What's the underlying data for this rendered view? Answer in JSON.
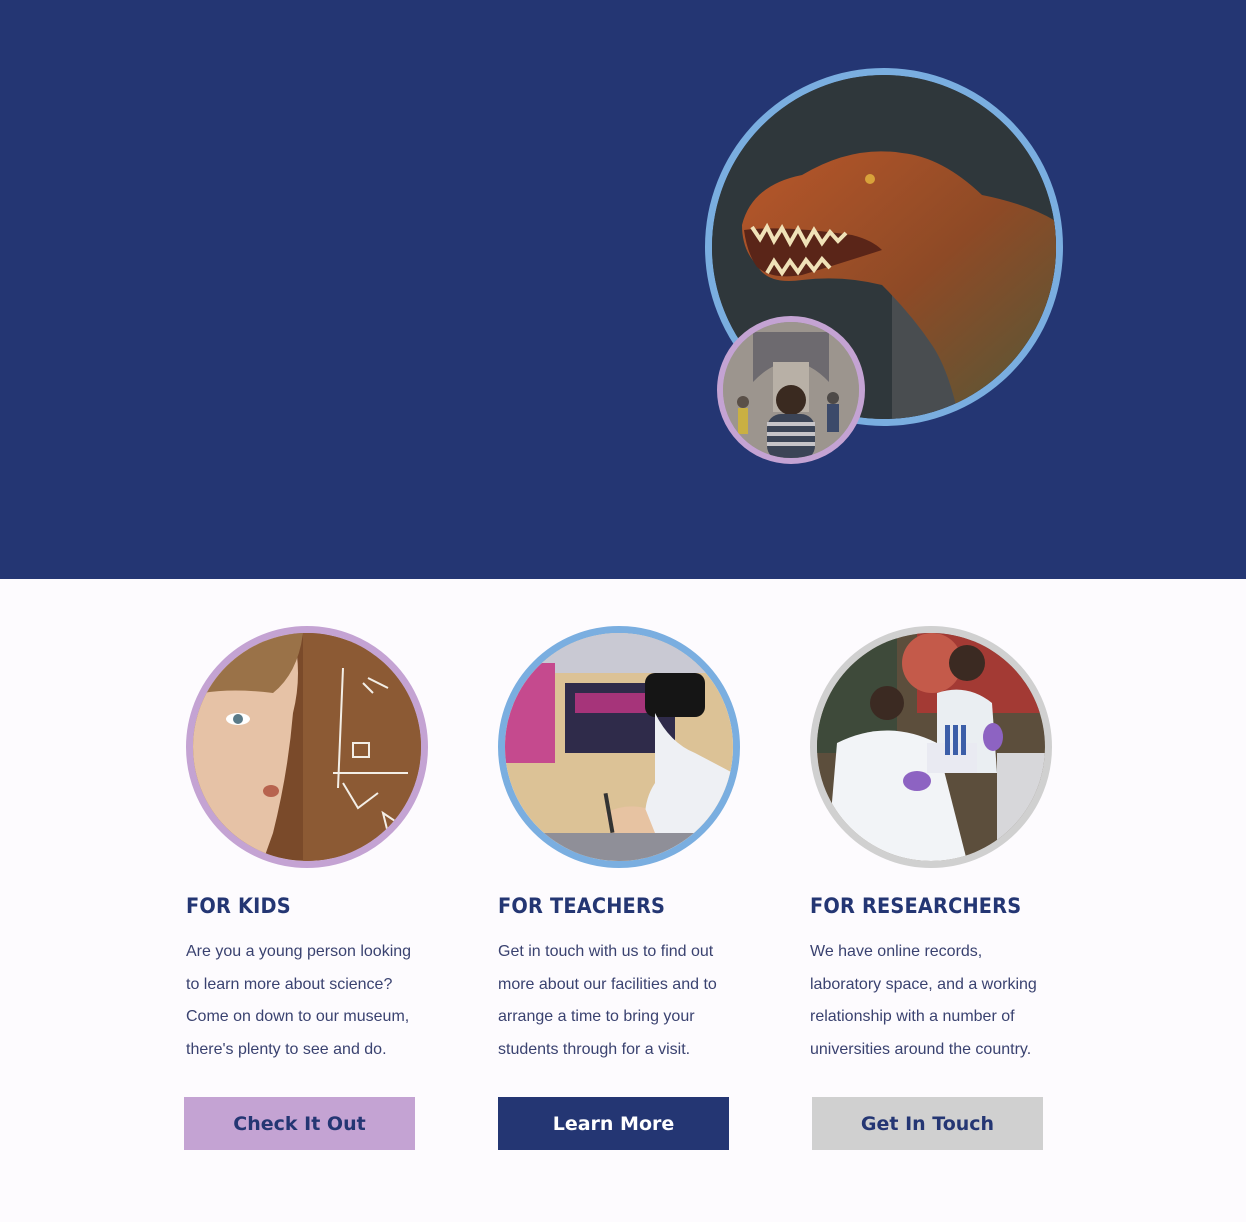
{
  "hero": {
    "main_image": "t-rex-dinosaur-photo",
    "secondary_image": "child-in-museum-hall-photo",
    "colors": {
      "background": "#243673",
      "main_ring": "#7aaee0",
      "secondary_ring": "#c4a3d3"
    }
  },
  "cards": [
    {
      "image": "child-with-chalkboard-photo",
      "title": "FOR KIDS",
      "text_lines": [
        "Are you a young person looking",
        "to learn more about science?",
        "Come on down to our museum,",
        "there's plenty to see and do."
      ],
      "button_label": "Check It Out",
      "ring_color": "#c4a3d3",
      "button_color": "#c4a3d3",
      "button_text_color": "#243673"
    },
    {
      "image": "student-with-vr-headset-photo",
      "title": "FOR TEACHERS",
      "text_lines": [
        "Get in touch with us to find out",
        "more about our facilities and to",
        "arrange a time to bring your",
        "students through for a visit."
      ],
      "button_label": "Learn More",
      "ring_color": "#7aaee0",
      "button_color": "#243673",
      "button_text_color": "#ffffff"
    },
    {
      "image": "researchers-in-lab-photo",
      "title": "FOR RESEARCHERS",
      "text_lines": [
        "We have online records,",
        "laboratory space, and a working",
        "relationship with a number of",
        "universities around the country."
      ],
      "button_label": "Get In Touch",
      "ring_color": "#d0d0d0",
      "button_color": "#d0d0d0",
      "button_text_color": "#243673"
    }
  ]
}
